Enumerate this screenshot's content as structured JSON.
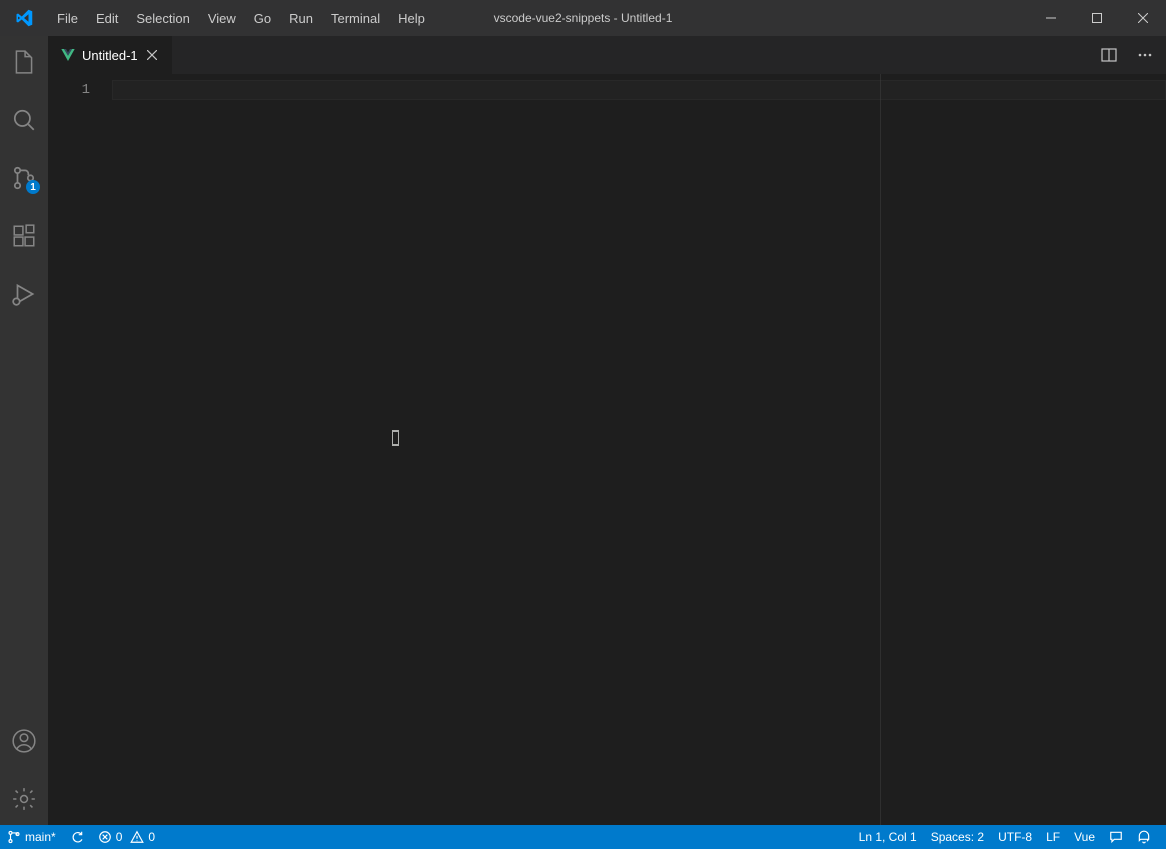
{
  "titlebar": {
    "menus": [
      "File",
      "Edit",
      "Selection",
      "View",
      "Go",
      "Run",
      "Terminal",
      "Help"
    ],
    "title": "vscode-vue2-snippets - Untitled-1"
  },
  "activitybar": {
    "items": [
      {
        "name": "explorer-icon",
        "badge": null
      },
      {
        "name": "search-icon",
        "badge": null
      },
      {
        "name": "source-control-icon",
        "badge": "1"
      },
      {
        "name": "extensions-icon",
        "badge": null
      },
      {
        "name": "run-debug-icon",
        "badge": null
      }
    ],
    "bottom": [
      {
        "name": "account-icon"
      },
      {
        "name": "gear-icon"
      }
    ]
  },
  "tabs": {
    "active": {
      "icon": "vue-icon",
      "label": "Untitled-1"
    },
    "actions": {
      "split": "split-editor-icon",
      "more": "more-icon"
    }
  },
  "editor": {
    "line_number": "1"
  },
  "statusbar": {
    "branch": "main*",
    "errors": "0",
    "warnings": "0",
    "cursor": "Ln 1, Col 1",
    "indent": "Spaces: 2",
    "encoding": "UTF-8",
    "eol": "LF",
    "language": "Vue"
  },
  "colors": {
    "accent": "#007acc",
    "vue": "#41b883"
  }
}
